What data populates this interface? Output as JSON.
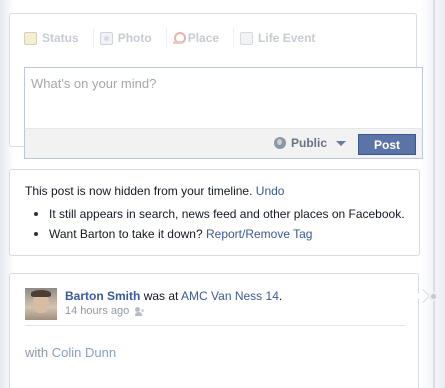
{
  "composer": {
    "tabs": [
      {
        "label": "Status",
        "icon": "status-icon"
      },
      {
        "label": "Photo",
        "icon": "photo-icon"
      },
      {
        "label": "Place",
        "icon": "place-icon"
      },
      {
        "label": "Life Event",
        "icon": "life-event-icon"
      }
    ],
    "placeholder": "What's on your mind?",
    "audience": "Public",
    "post_label": "Post"
  },
  "notice": {
    "headline": "This post is now hidden from your timeline.",
    "undo": "Undo",
    "bullet1": "It still appears in search, news feed and other places on Facebook.",
    "bullet2_prefix": "Want Barton to take it down?",
    "bullet2_link": "Report/Remove Tag"
  },
  "story": {
    "author": "Barton Smith",
    "was_at": "was at",
    "place": "AMC Van Ness 14",
    "period": ".",
    "time": "14 hours ago",
    "with_prefix": "with",
    "with_name": "Colin Dunn"
  },
  "colors": {
    "link": "#3b5998",
    "post_button": "#5b74a8"
  }
}
